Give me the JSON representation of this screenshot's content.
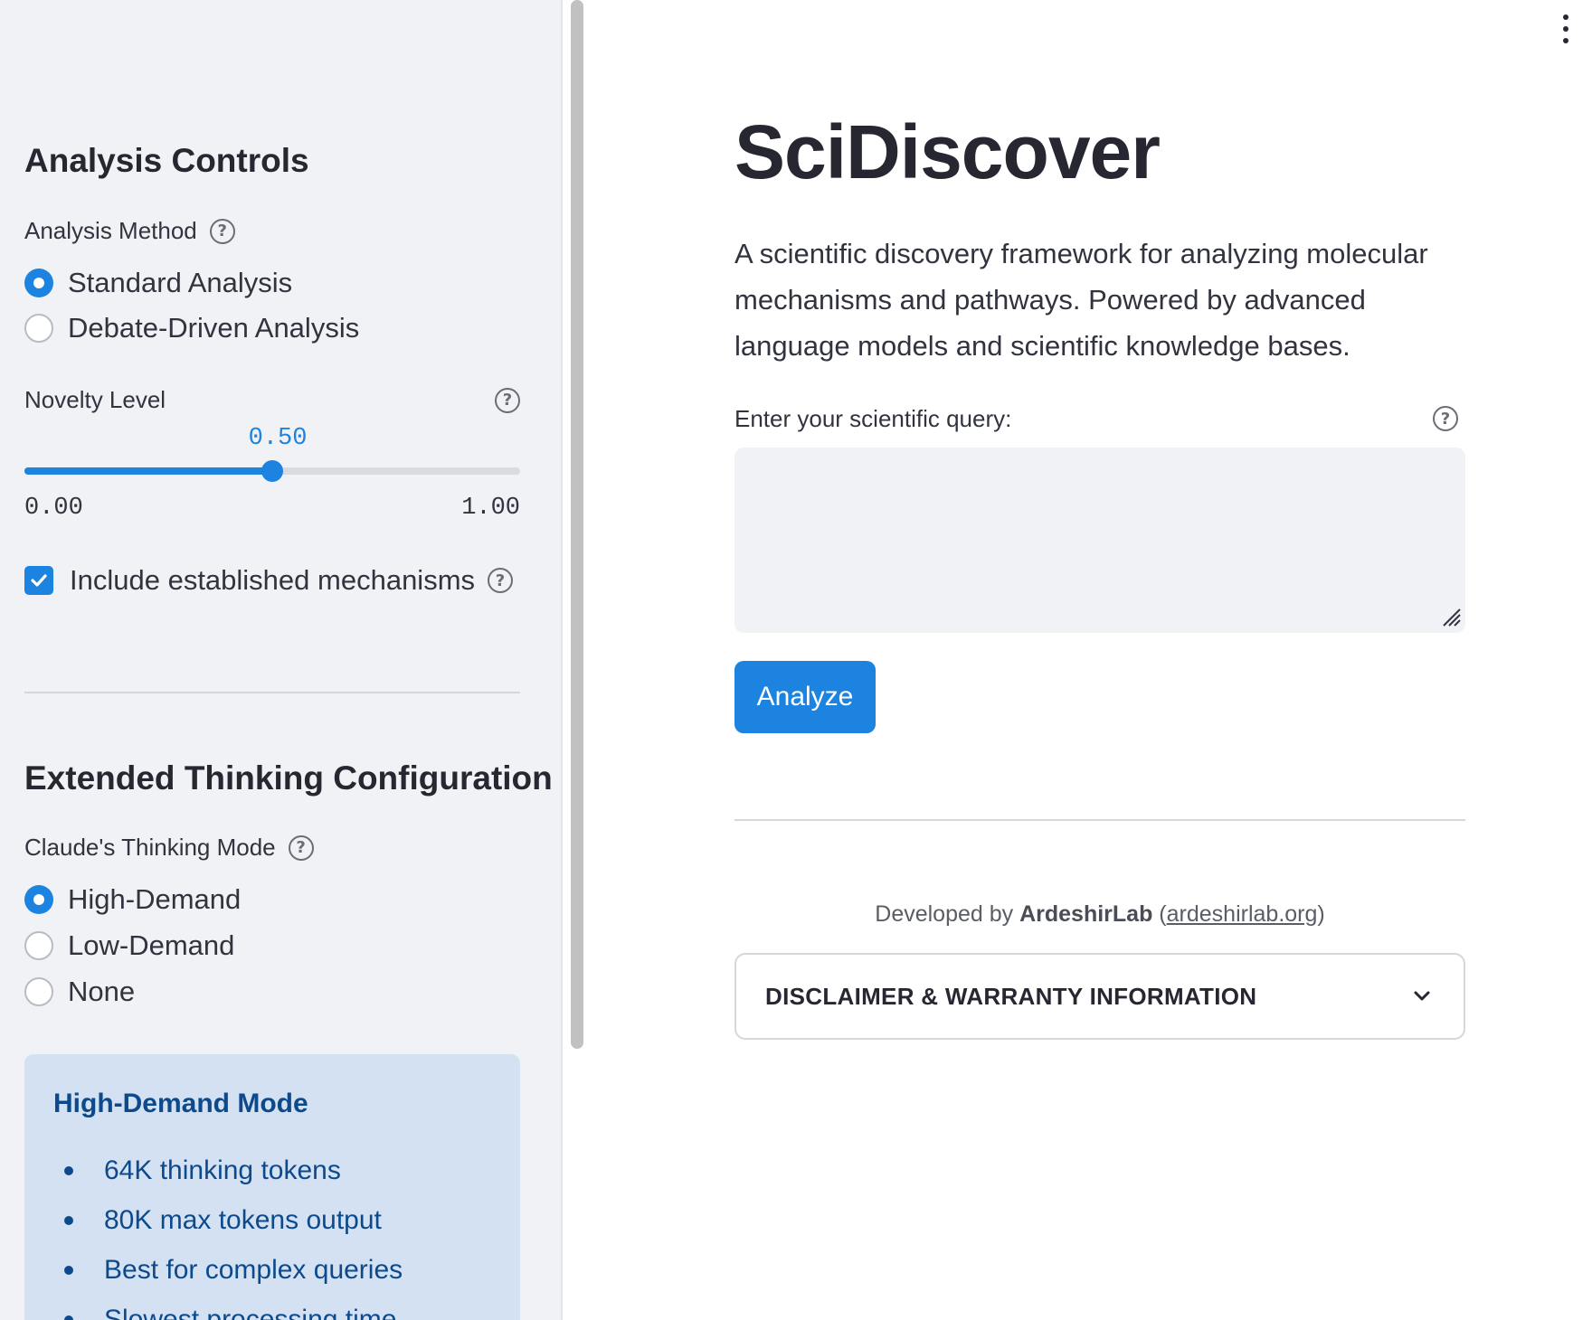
{
  "sidebar": {
    "analysis_controls_title": "Analysis Controls",
    "analysis_method": {
      "label": "Analysis Method",
      "options": [
        "Standard Analysis",
        "Debate-Driven Analysis"
      ],
      "selected": "Standard Analysis"
    },
    "novelty": {
      "label": "Novelty Level",
      "value_text": "0.50",
      "value": 0.5,
      "min_text": "0.00",
      "max_text": "1.00"
    },
    "include_established": {
      "label": "Include established mechanisms",
      "checked": true
    },
    "extended_title": "Extended Thinking Configuration",
    "thinking_mode": {
      "label": "Claude's Thinking Mode",
      "options": [
        "High-Demand",
        "Low-Demand",
        "None"
      ],
      "selected": "High-Demand"
    },
    "info_box": {
      "title": "High-Demand Mode",
      "items": [
        "64K thinking tokens",
        "80K max tokens output",
        "Best for complex queries",
        "Slowest processing time"
      ]
    }
  },
  "main": {
    "title": "SciDiscover",
    "description": "A scientific discovery framework for analyzing molecular mechanisms and pathways. Powered by advanced language models and scientific knowledge bases.",
    "query_label": "Enter your scientific query:",
    "query_value": "",
    "analyze_label": "Analyze",
    "credit_prefix": "Developed by ",
    "credit_org": "ArdeshirLab",
    "credit_link": "ardeshirlab.org",
    "disclaimer_label": "DISCLAIMER & WARRANTY INFORMATION"
  },
  "colors": {
    "accent": "#1c83e1",
    "sidebar_bg": "#f0f2f6",
    "info_bg": "#d4e1f2",
    "info_text": "#0d4a8c"
  },
  "icons": [
    "help-icon",
    "check-icon",
    "chevron-down-icon",
    "kebab-menu-icon",
    "resize-grip-icon"
  ]
}
